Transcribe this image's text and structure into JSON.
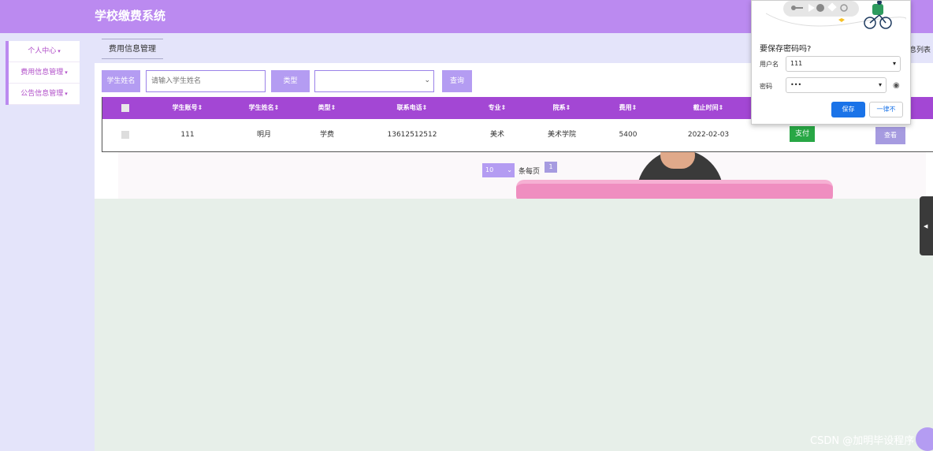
{
  "app": {
    "title": "学校缴费系统"
  },
  "sidebar": {
    "items": [
      {
        "label": "个人中心",
        "caret": "▾"
      },
      {
        "label": "费用信息管理",
        "caret": "▾"
      },
      {
        "label": "公告信息管理",
        "caret": "▾"
      }
    ]
  },
  "tabs": {
    "active": "费用信息管理",
    "right_fragment": "息列表"
  },
  "search": {
    "name_label": "学生姓名",
    "name_placeholder": "请输入学生姓名",
    "type_label": "类型",
    "type_value": "",
    "query_button": "查询"
  },
  "table": {
    "headers": [
      "学生账号",
      "学生姓名",
      "类型",
      "联系电话",
      "专业",
      "院系",
      "费用",
      "截止时间"
    ],
    "sort_icon": "sort-icon",
    "rows": [
      {
        "student_account": "111",
        "student_name": "明月",
        "type": "学费",
        "phone": "13612512512",
        "major": "美术",
        "department": "美术学院",
        "fee": "5400",
        "deadline": "2022-02-03",
        "pay_button": "支付",
        "view_button": "查看"
      }
    ]
  },
  "pagination": {
    "page_size": "10",
    "per_page_label": "条每页",
    "current_page": "1"
  },
  "password_popup": {
    "title": "要保存密码吗?",
    "username_label": "用户名",
    "username_value": "111",
    "password_label": "密码",
    "password_value": "•••",
    "save_button": "保存",
    "never_button": "一律不"
  },
  "watermark": "CSDN @加明毕设程序",
  "colors": {
    "topbar": "#bb8af0",
    "table_header": "#a347d4",
    "accent_button": "#b49cf2",
    "pay_button": "#28a745",
    "save_button": "#1a73e8"
  }
}
